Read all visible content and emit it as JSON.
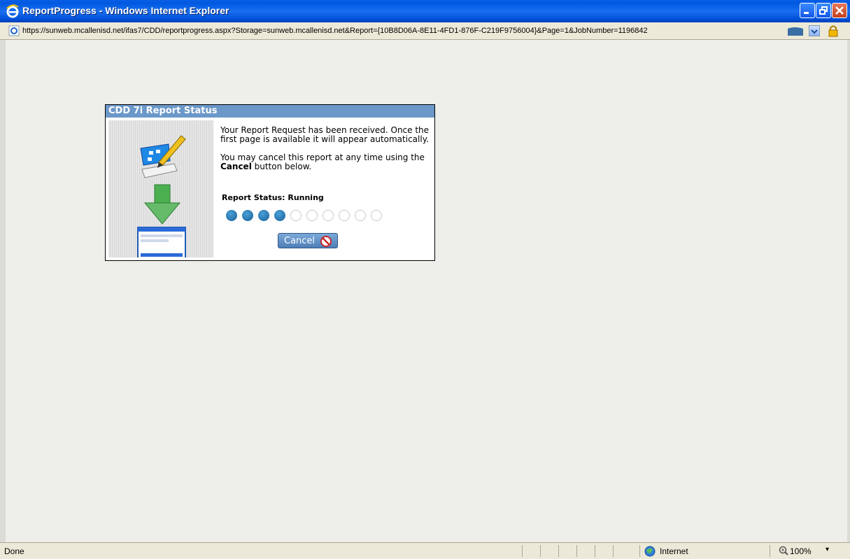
{
  "window": {
    "title": "ReportProgress - Windows Internet Explorer",
    "url": "https://sunweb.mcallenisd.net/ifas7/CDD/reportprogress.aspx?Storage=sunweb.mcallenisd.net&Report={10B8D06A-8E11-4FD1-876F-C219F9756004}&Page=1&JobNumber=1196842"
  },
  "dialog": {
    "header": "CDD 7i Report Status",
    "message1": "Your Report Request has been received. Once the first page is available it will appear automatically.",
    "message2_prefix": "You may cancel this report at any time using the ",
    "message2_bold": "Cancel",
    "message2_suffix": " button below.",
    "status_label": "Report Status: Running",
    "progress_steps_total": 10,
    "progress_steps_done": 4,
    "cancel_label": "Cancel"
  },
  "statusbar": {
    "status": "Done",
    "zone": "Internet",
    "zoom": "100%"
  },
  "colors": {
    "titlebar": "#0058e0",
    "dialog_header": "#6b98c9",
    "progress_on": "#1a5f9a"
  }
}
